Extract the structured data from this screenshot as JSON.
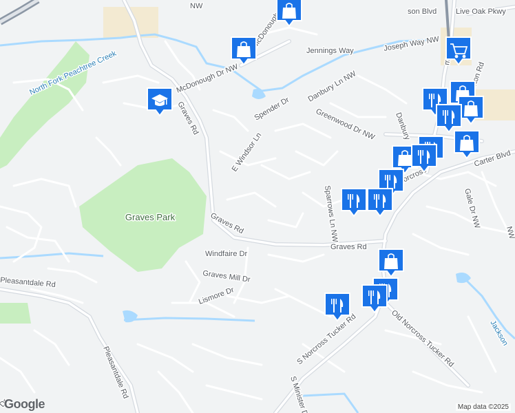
{
  "map": {
    "colors": {
      "background": "#f1f3f4",
      "park": "#c8eec0",
      "water": "#aadaff",
      "road_minor": "#ffffff",
      "road_major": "#cfd4da",
      "highway": "#8c97a5",
      "commercial": "#f3ead2",
      "marker": "#1a73e8"
    },
    "labels": {
      "graves_park": "Graves Park",
      "north_fork_creek": "North Fork Peachtree Creek",
      "graves_rd_north": "Graves Rd",
      "graves_rd_mid": "Graves Rd",
      "graves_rd_east": "Graves Rd",
      "mcdonough": "McDonough Dr NW",
      "mcdonough_top": "McDonough",
      "jennings": "Jennings Way",
      "joseph": "Joseph Way NW",
      "danbury": "Danbury Ln NW",
      "danbury2": "Danbury",
      "spender": "Spender Dr",
      "greenwood": "Greenwood Dr NW",
      "windsor": "E Windsor Ln",
      "sparrows": "Sparrows Ln NW",
      "windfaire": "Windfaire Dr",
      "graves_mill": "Graves Mill Dr",
      "lismore": "Lismore Dr",
      "pleasantdale_w": "Pleasantdale Rd",
      "pleasantdale_s": "Pleasantdale Rd",
      "s_norcross": "S Norcross Tucker Rd",
      "old_norcross": "Old Norcross Tucker Rd",
      "s_minister": "S Minister Dr",
      "jackson": "Jackson",
      "gale": "Gale Dr NW",
      "carter": "Carter Blvd",
      "norcross": "Norcross",
      "live_oak": "Live Oak Pkwy",
      "son_blvd": "son Blvd",
      "nw_top": "NW",
      "nw_right": "NW",
      "my_c": "my C",
      "eton": "eton Rd",
      "dr_sw": "Dr"
    },
    "markers": [
      {
        "type": "shopping",
        "icon": "shopping-bag-icon"
      },
      {
        "type": "shopping",
        "icon": "shopping-bag-icon"
      },
      {
        "type": "school",
        "icon": "graduation-cap-icon"
      },
      {
        "type": "shopping",
        "icon": "shopping-cart-icon"
      },
      {
        "type": "shopping",
        "icon": "shopping-bag-icon"
      },
      {
        "type": "shopping",
        "icon": "shopping-bag-icon"
      },
      {
        "type": "restaurant",
        "icon": "fork-knife-icon"
      },
      {
        "type": "restaurant",
        "icon": "fork-knife-icon"
      },
      {
        "type": "shopping",
        "icon": "shopping-bag-icon"
      },
      {
        "type": "restaurant",
        "icon": "fork-knife-icon"
      },
      {
        "type": "shopping",
        "icon": "shopping-bag-icon"
      },
      {
        "type": "restaurant",
        "icon": "fork-knife-icon"
      },
      {
        "type": "restaurant",
        "icon": "fork-knife-icon"
      },
      {
        "type": "restaurant",
        "icon": "fork-knife-icon"
      },
      {
        "type": "restaurant",
        "icon": "fork-knife-icon"
      },
      {
        "type": "restaurant",
        "icon": "fork-knife-icon"
      },
      {
        "type": "restaurant",
        "icon": "fork-knife-icon"
      },
      {
        "type": "shopping",
        "icon": "shopping-bag-icon"
      },
      {
        "type": "restaurant",
        "icon": "fork-knife-icon"
      },
      {
        "type": "restaurant",
        "icon": "fork-knife-icon"
      },
      {
        "type": "restaurant",
        "icon": "fork-knife-icon"
      }
    ],
    "logo": "Google",
    "attribution": "Map data ©2025"
  }
}
